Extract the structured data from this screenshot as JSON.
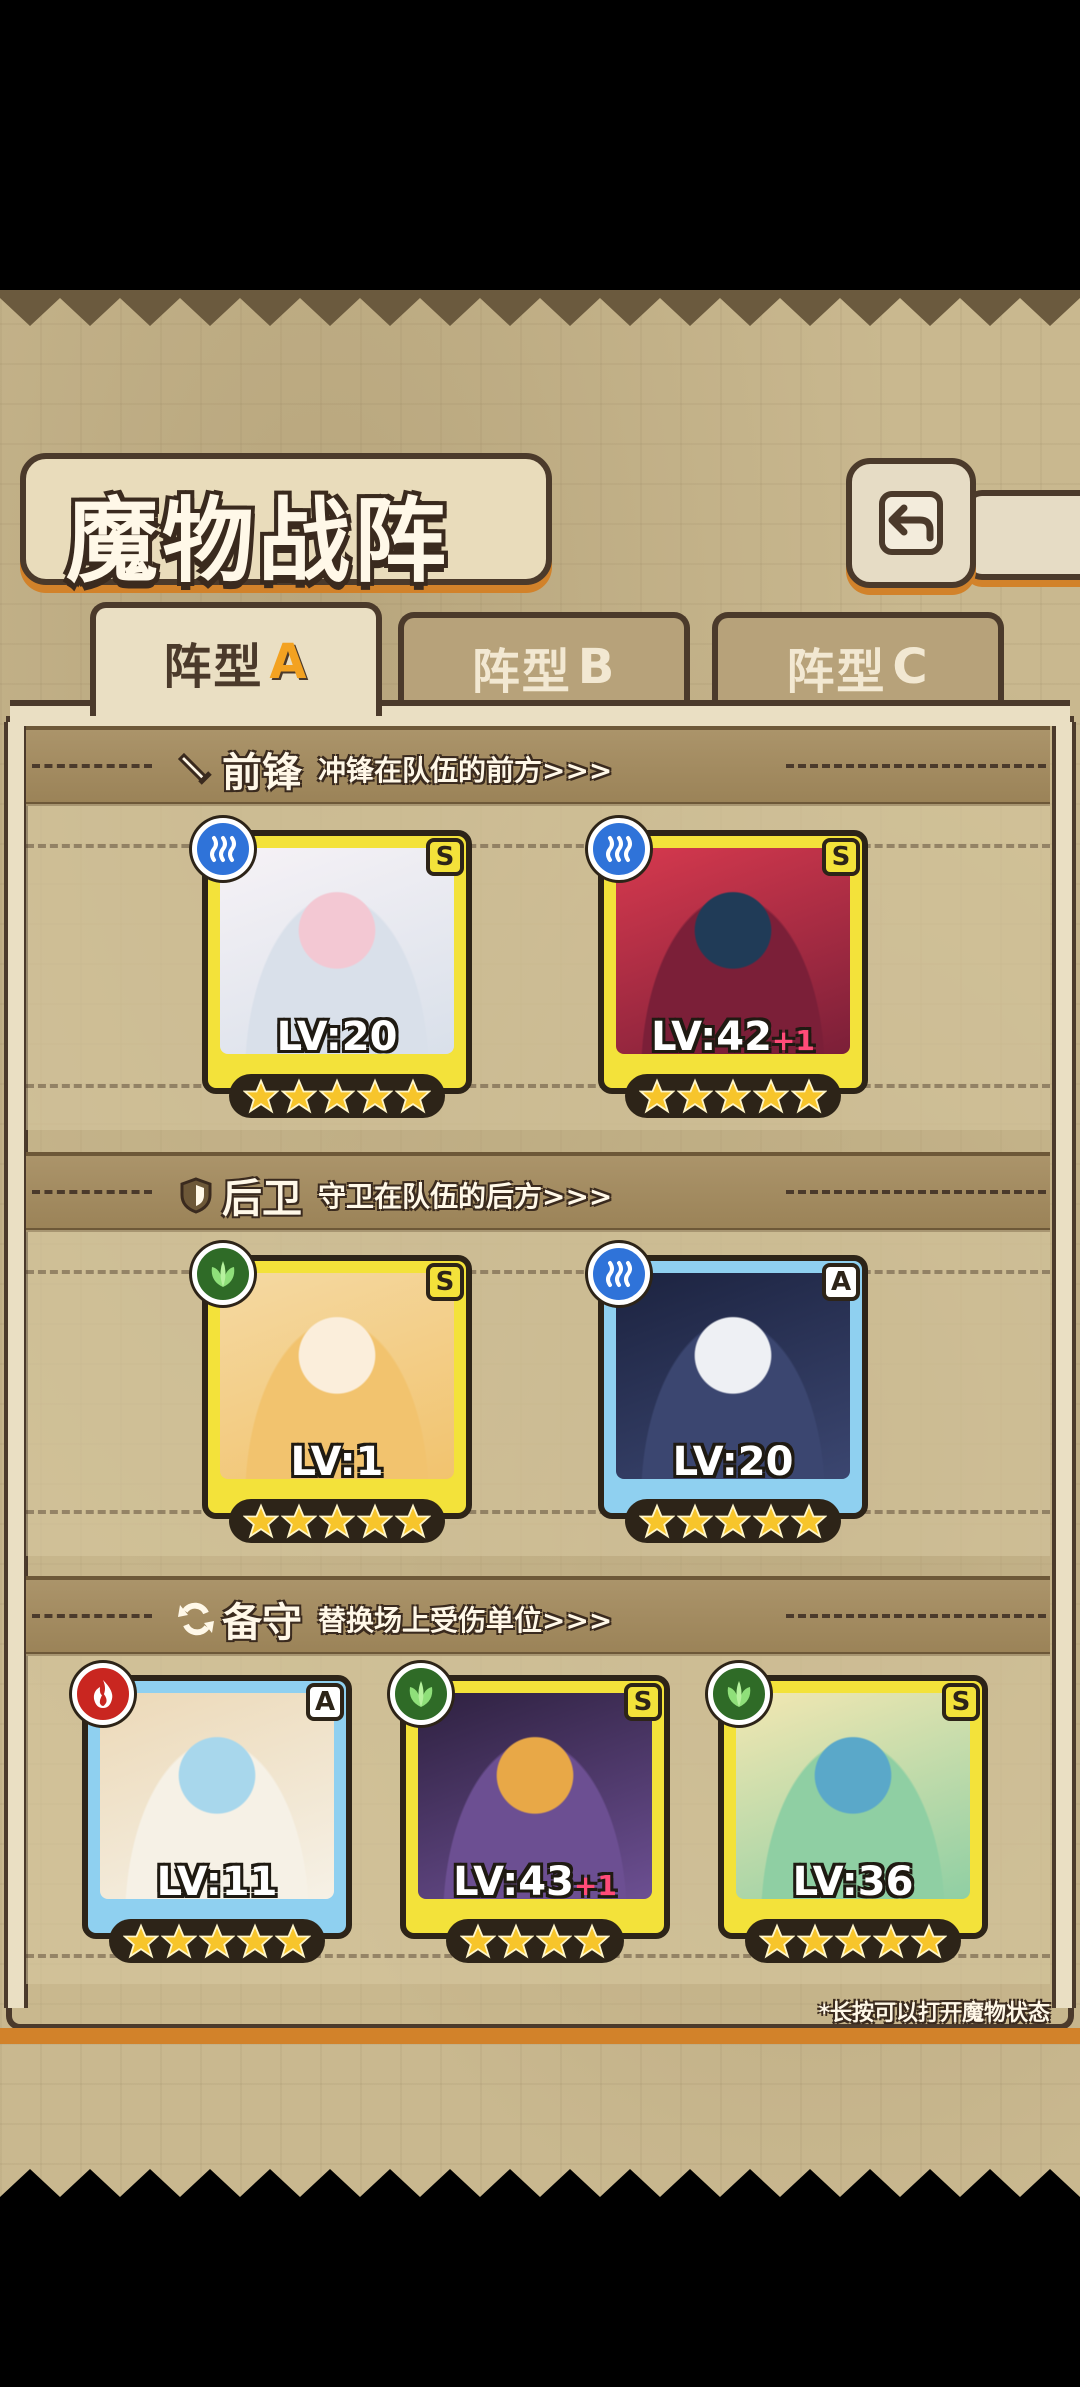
{
  "title": "魔物战阵",
  "tabs": [
    {
      "prefix": "阵型",
      "letter": "A",
      "active": true
    },
    {
      "prefix": "阵型",
      "letter": "B",
      "active": false
    },
    {
      "prefix": "阵型",
      "letter": "C",
      "active": false
    }
  ],
  "sections": {
    "front": {
      "title": "前锋",
      "subtitle": "冲锋在队伍的前方>>>",
      "icon": "sword-icon"
    },
    "back": {
      "title": "后卫",
      "subtitle": "守卫在队伍的后方>>>",
      "icon": "shield-icon"
    },
    "reserve": {
      "title": "备守",
      "subtitle": "替换场上受伤单位>>>",
      "icon": "swap-icon"
    }
  },
  "front_cards": [
    {
      "level": "LV:20",
      "plus": "",
      "rank": "S",
      "element": "water",
      "stars": 5,
      "frame": "gold",
      "portrait_colors": [
        "#f6f2f6",
        "#d9e0ea",
        "#f3c8d3"
      ]
    },
    {
      "level": "LV:42",
      "plus": "+1",
      "rank": "S",
      "element": "water",
      "stars": 5,
      "frame": "gold",
      "portrait_colors": [
        "#d6394e",
        "#7b1f38",
        "#203b57"
      ]
    }
  ],
  "back_cards": [
    {
      "level": "LV:1",
      "plus": "",
      "rank": "S",
      "element": "grass",
      "stars": 5,
      "frame": "gold",
      "portrait_colors": [
        "#f4d9a2",
        "#f2c36e",
        "#fbeedb"
      ]
    },
    {
      "level": "LV:20",
      "plus": "",
      "rank": "A",
      "element": "water",
      "stars": 5,
      "frame": "blue",
      "portrait_colors": [
        "#1c2340",
        "#3b4670",
        "#eef0f4"
      ]
    }
  ],
  "reserve_cards": [
    {
      "level": "LV:11",
      "plus": "",
      "rank": "A",
      "element": "fire",
      "stars": 5,
      "frame": "blue",
      "portrait_colors": [
        "#ecd9b8",
        "#f6f1e6",
        "#a8d7ec"
      ]
    },
    {
      "level": "LV:43",
      "plus": "+1",
      "rank": "S",
      "element": "grass",
      "stars": 4,
      "frame": "gold",
      "portrait_colors": [
        "#2e2140",
        "#6c4f92",
        "#e8a847"
      ]
    },
    {
      "level": "LV:36",
      "plus": "",
      "rank": "S",
      "element": "grass",
      "stars": 5,
      "frame": "gold",
      "portrait_colors": [
        "#f3e7b2",
        "#8fcfa3",
        "#5aa8c9"
      ]
    }
  ],
  "hint": "*长按可以打开魔物状态",
  "colors": {
    "accent_orange": "#d2822a",
    "frame_dark": "#4b3a2b",
    "card_gold": "#f3e23a",
    "card_blue": "#8fd0f0"
  }
}
